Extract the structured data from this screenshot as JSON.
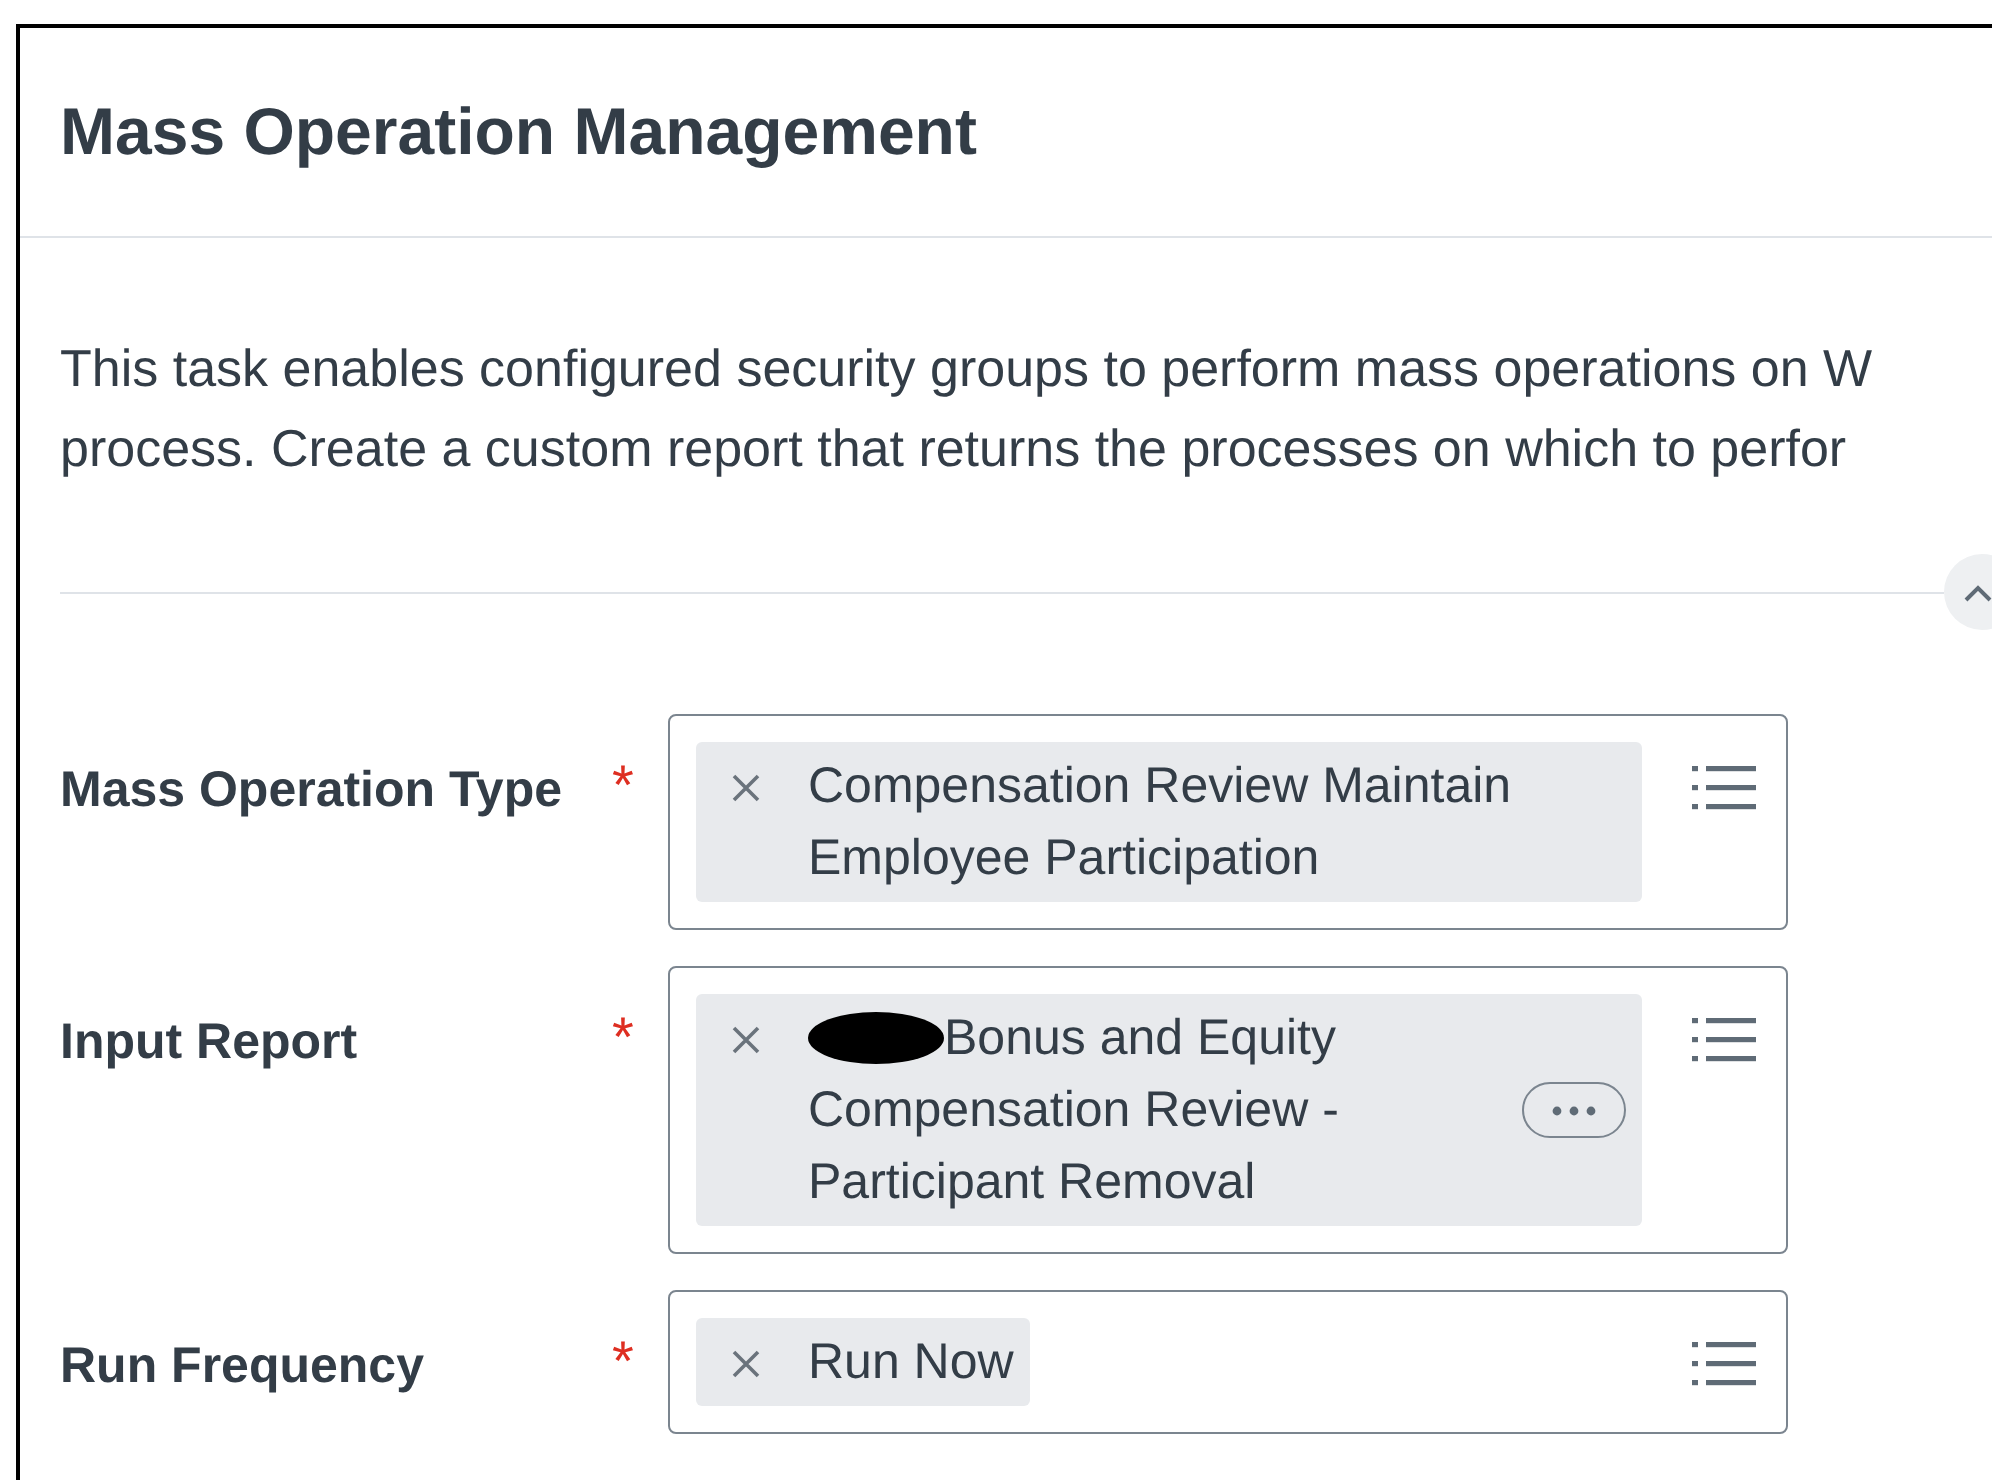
{
  "title": "Mass Operation Management",
  "description": [
    "This task enables configured security groups to perform mass operations on W",
    "process. Create a custom report that returns the processes on which to perfor"
  ],
  "collapsed": false,
  "fields": [
    {
      "label": "Mass Operation Type",
      "required_mark": "*",
      "value_lines": [
        "Compensation Review Maintain",
        "Employee Participation"
      ],
      "redacted_prefix": false,
      "more_button": false
    },
    {
      "label": "Input Report",
      "required_mark": "*",
      "value_lines": [
        "Bonus and Equity",
        "Compensation Review -",
        "Participant Removal"
      ],
      "redacted_prefix": true,
      "more_button": true
    },
    {
      "label": "Run Frequency",
      "required_mark": "*",
      "value_lines": [
        "Run Now"
      ],
      "redacted_prefix": false,
      "more_button": false
    }
  ]
}
